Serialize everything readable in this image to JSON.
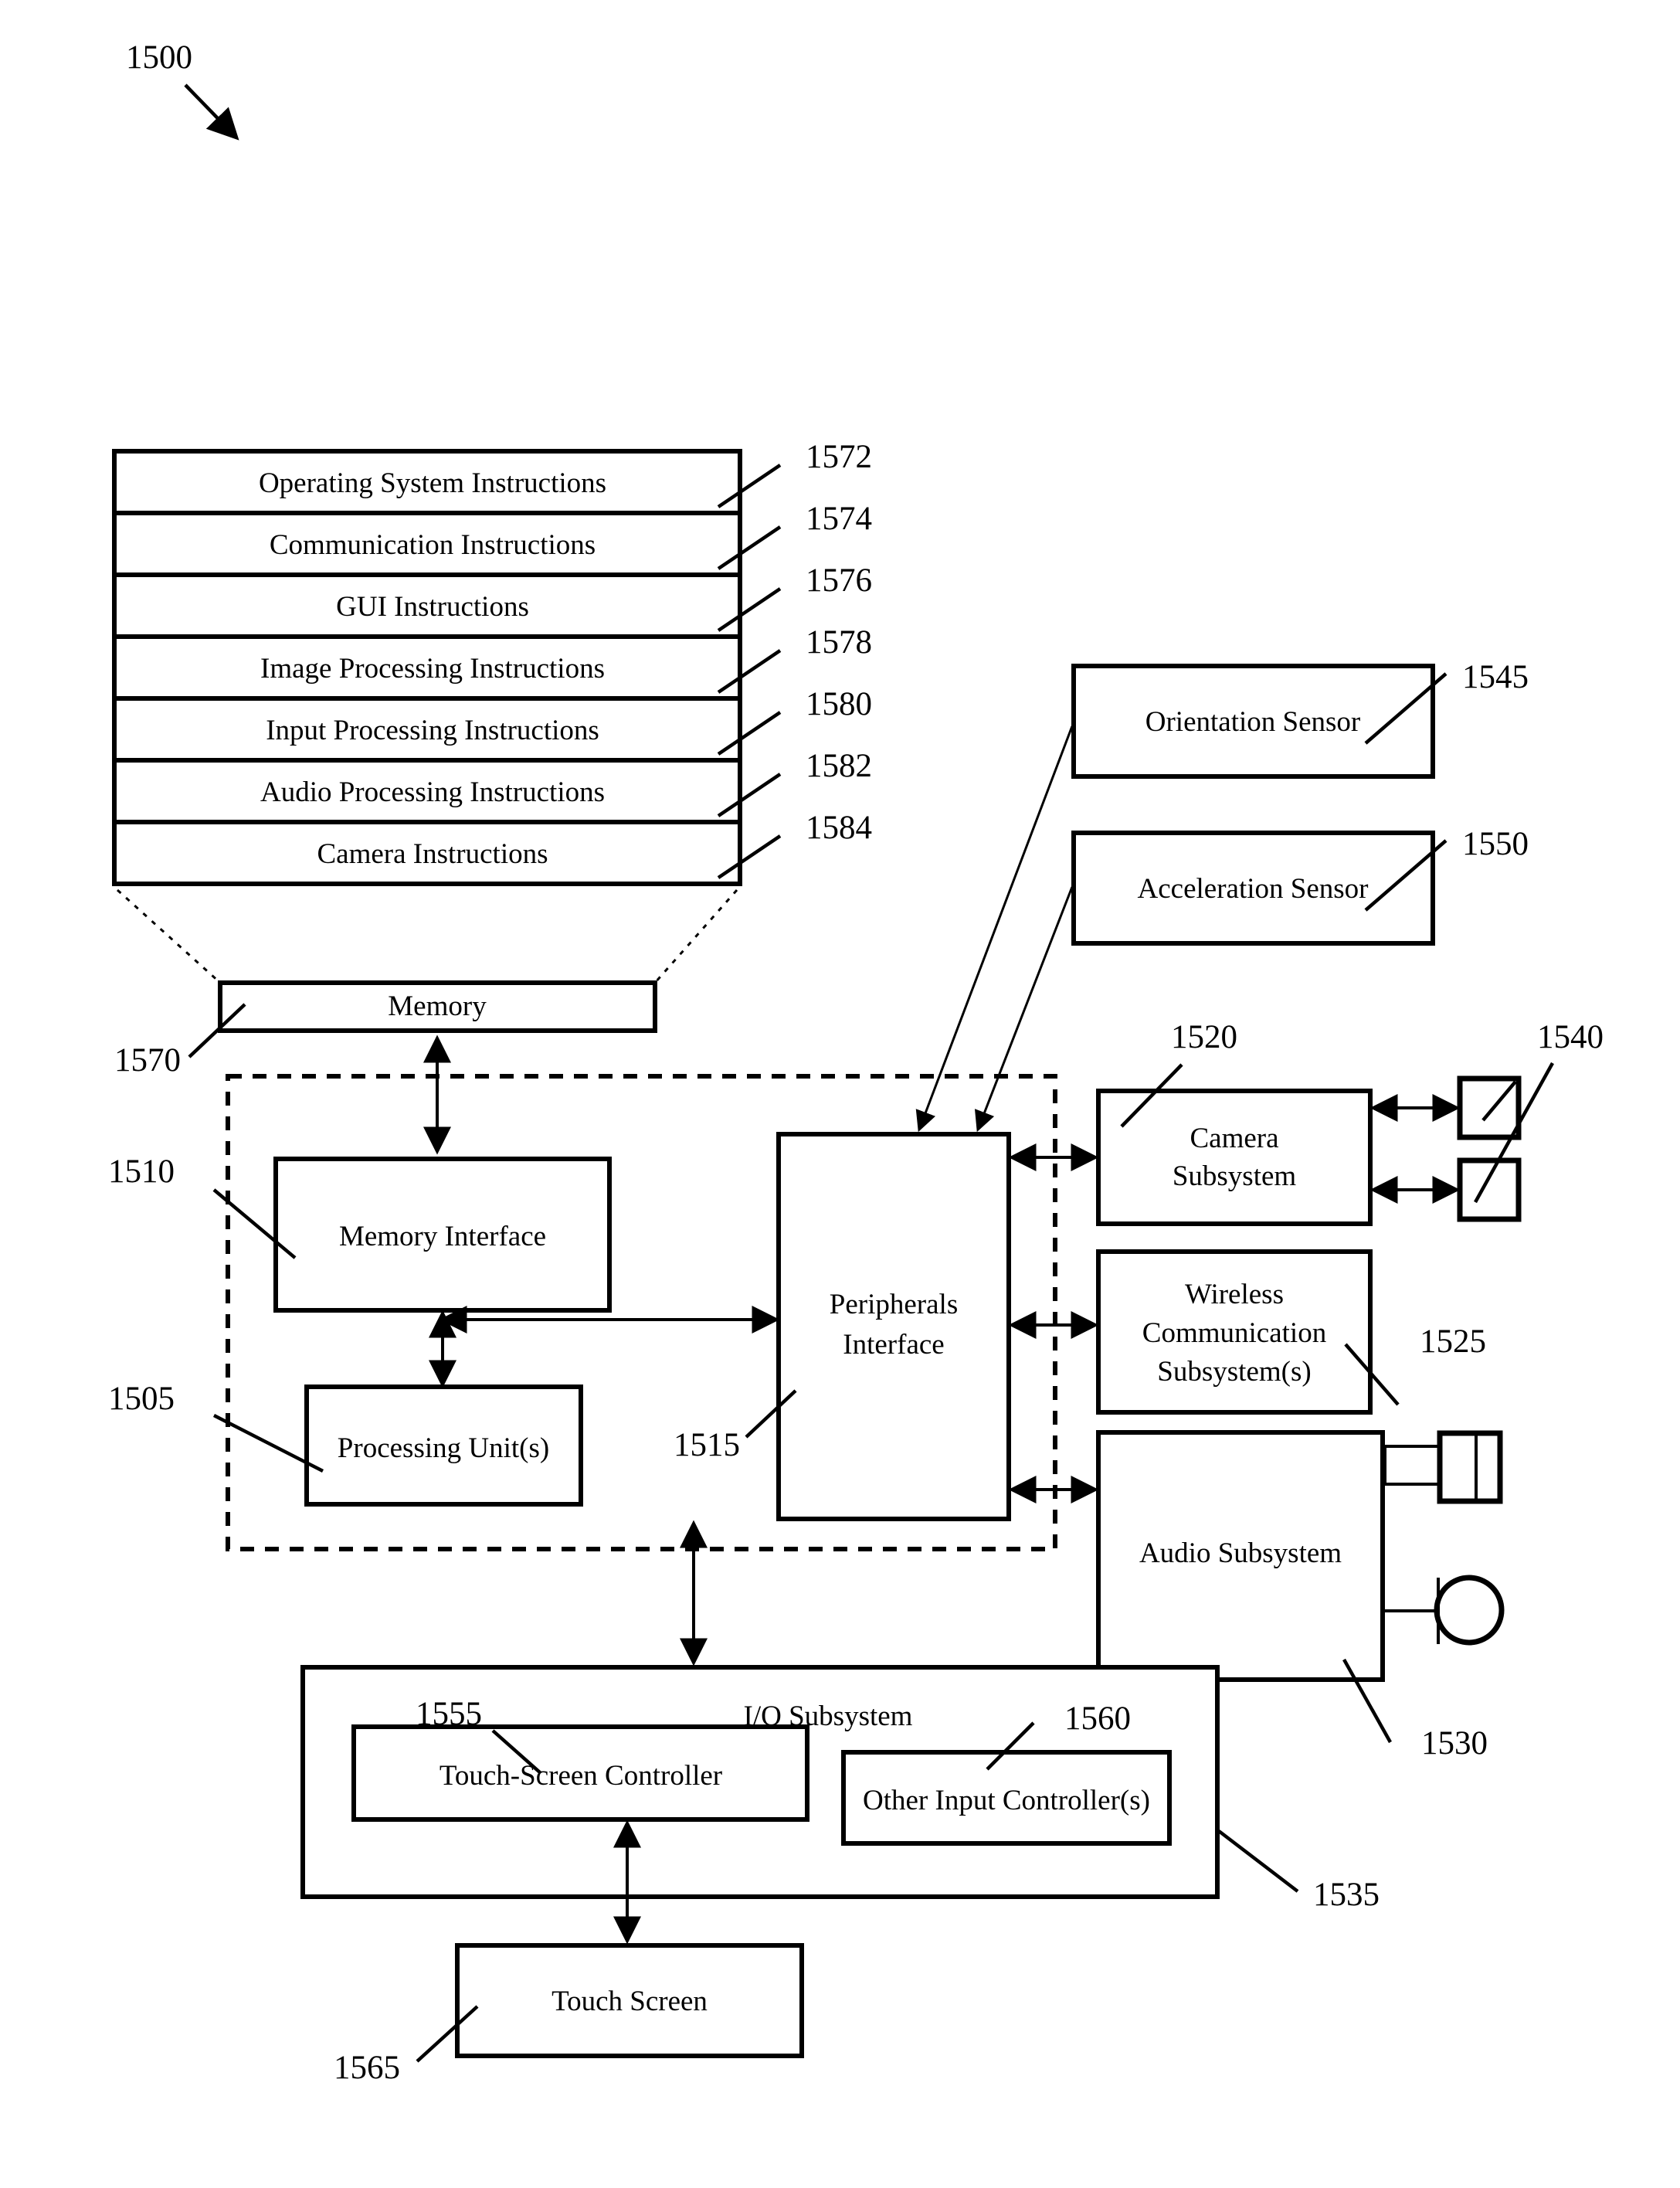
{
  "figure": {
    "figure_number": "1500",
    "memory_stack": {
      "rows": [
        {
          "label": "Operating System Instructions",
          "ref": "1572"
        },
        {
          "label": "Communication Instructions",
          "ref": "1574"
        },
        {
          "label": "GUI Instructions",
          "ref": "1576"
        },
        {
          "label": "Image Processing Instructions",
          "ref": "1578"
        },
        {
          "label": "Input Processing Instructions",
          "ref": "1580"
        },
        {
          "label": "Audio Processing Instructions",
          "ref": "1582"
        },
        {
          "label": "Camera Instructions",
          "ref": "1584"
        }
      ]
    },
    "blocks": {
      "memory": {
        "label": "Memory",
        "ref": "1570"
      },
      "memory_interface": {
        "label": "Memory Interface",
        "ref": "1510"
      },
      "processing_unit": {
        "label": "Processing Unit(s)",
        "ref": "1505"
      },
      "peripherals": {
        "label_line1": "Peripherals",
        "label_line2": "Interface",
        "ref": "1515"
      },
      "orientation_sensor": {
        "label": "Orientation Sensor",
        "ref": "1545"
      },
      "acceleration_sensor": {
        "label": "Acceleration Sensor",
        "ref": "1550"
      },
      "camera_subsystem": {
        "label_line1": "Camera",
        "label_line2": "Subsystem",
        "ref": "1520"
      },
      "optical_sensors": {
        "ref": "1540"
      },
      "wireless_subsystem": {
        "label_line1": "Wireless",
        "label_line2": "Communication",
        "label_line3": "Subsystem(s)",
        "ref": "1525"
      },
      "audio_subsystem": {
        "label": "Audio Subsystem",
        "ref": "1530"
      },
      "io_subsystem": {
        "label": "I/O Subsystem",
        "ref": "1535"
      },
      "touch_screen_controller": {
        "label": "Touch-Screen Controller",
        "ref": "1555"
      },
      "other_input_controller": {
        "label": "Other Input Controller(s)",
        "ref": "1560"
      },
      "touch_screen": {
        "label": "Touch Screen",
        "ref": "1565"
      }
    },
    "colors": {
      "ink": "#000000",
      "paper": "#ffffff"
    }
  }
}
